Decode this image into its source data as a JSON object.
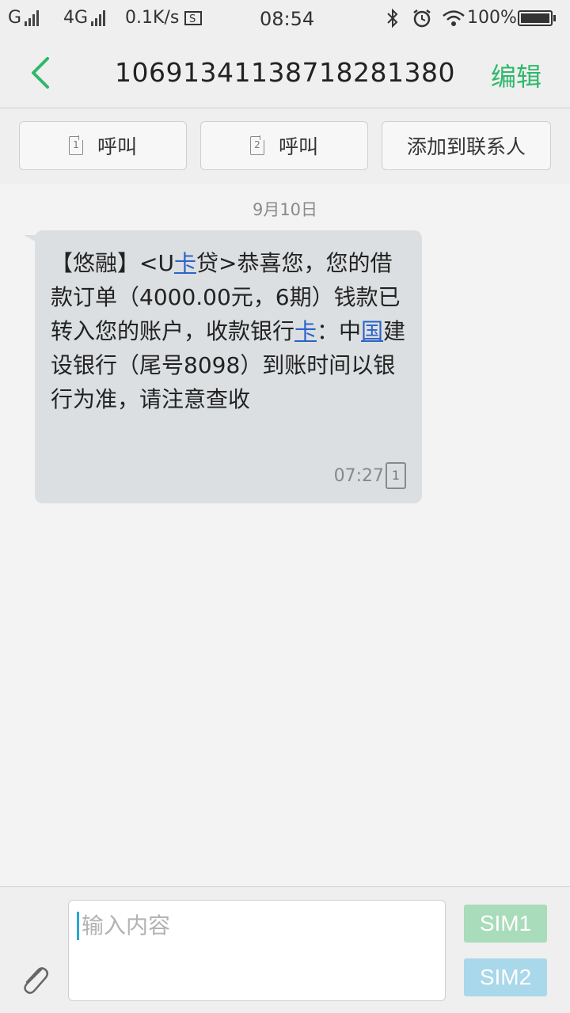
{
  "status_bar": {
    "carrier1": "G",
    "carrier2": "4G",
    "speed": "0.1K/s",
    "time": "08:54",
    "battery": "100%"
  },
  "header": {
    "title": "106913411387182813​80",
    "edit_label": "编辑"
  },
  "actions": [
    {
      "label": "呼叫",
      "sim": "1"
    },
    {
      "label": "呼叫",
      "sim": "2"
    },
    {
      "label": "添加到联系人"
    }
  ],
  "conversation": {
    "date": "9月10日",
    "message": {
      "text": "【悠融】<U卡贷>恭喜您，您的借款订单（4000.00元，6期）钱款已转入您的账户，收款银行卡：中国建设银行（尾号8098）到账时间以银行为准，请注意查收",
      "time": "07:27",
      "sim": "1"
    }
  },
  "composer": {
    "placeholder": "输入内容",
    "sim1_label": "SIM1",
    "sim2_label": "SIM2"
  },
  "colors": {
    "accent": "#2fb86b",
    "bubble": "#dcdfe1",
    "link": "#2a63c8",
    "sim1": "#a9dcba",
    "sim2": "#a8d8ea"
  }
}
